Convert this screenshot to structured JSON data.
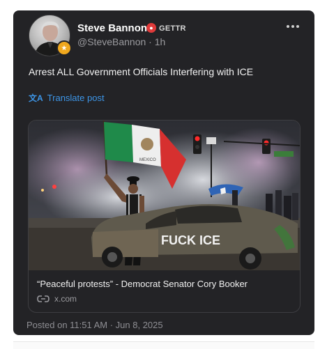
{
  "post": {
    "author": {
      "name": "Steve Bannon",
      "badge_text": "GETTR",
      "handle": "@SteveBannon",
      "age": "1h",
      "avatar_icon": "user-avatar",
      "verified_icon": "flame-icon"
    },
    "text": "Arrest ALL Government Officials Interfering with ICE",
    "translate_label": "Translate post",
    "link_preview": {
      "title": "“Peaceful protests” - Democrat Senator Cory Booker",
      "domain": "x.com",
      "image_graffiti": "FUCK ICE",
      "flag_text": "MEXICO"
    },
    "posted_on": "Posted on 11:51 AM · Jun 8, 2025"
  },
  "colors": {
    "card_bg": "#232326",
    "link_blue": "#3d96e8",
    "muted": "#8e8e93",
    "accent_red": "#e03a3a"
  }
}
